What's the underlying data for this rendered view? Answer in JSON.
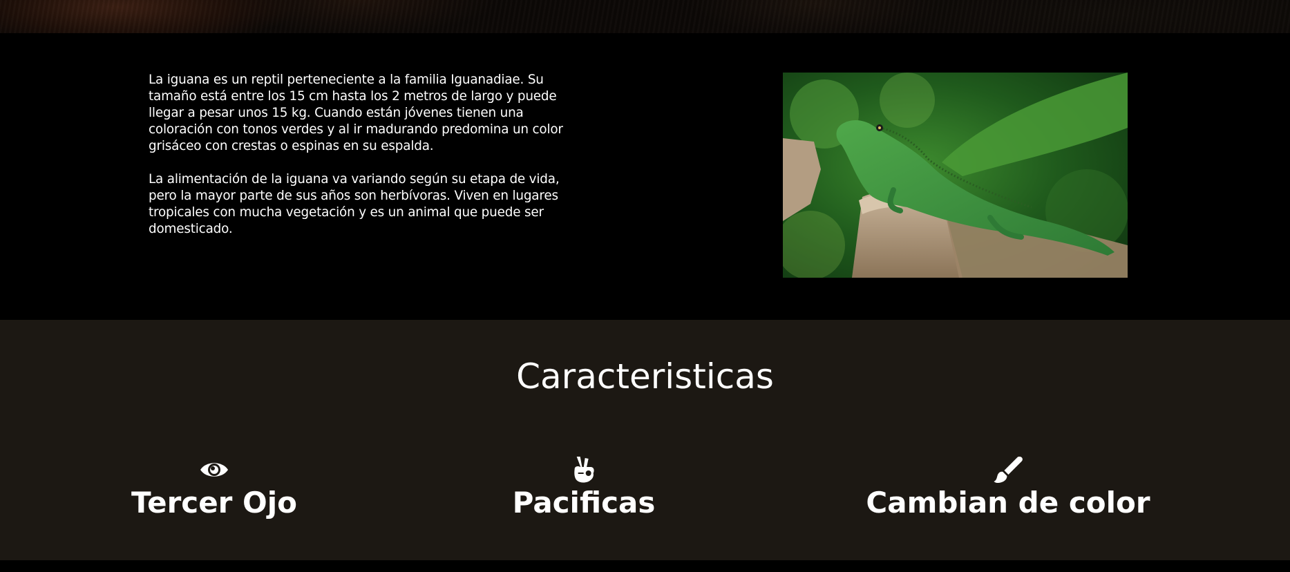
{
  "about": {
    "paragraphs": [
      "La iguana es un reptil perteneciente a la familia Iguanadiae. Su tamaño está entre los 15 cm hasta los 2 metros de largo y puede llegar a pesar unos 15 kg. Cuando están jóvenes tienen una coloración con tonos verdes y al ir madurando predomina un color grisáceo con crestas o espinas en su espalda.",
      "La alimentación de la iguana va variando según su etapa de vida, pero la mayor parte de sus años son herbívoras. Viven en lugares tropicales con mucha vegetación y es un animal que puede ser domesticado."
    ]
  },
  "features": {
    "title": "Caracteristicas",
    "items": [
      {
        "icon": "eye-icon",
        "title": "Tercer Ojo"
      },
      {
        "icon": "peace-hand-icon",
        "title": "Pacificas"
      },
      {
        "icon": "paintbrush-icon",
        "title": "Cambian de color"
      }
    ]
  },
  "colors": {
    "about_bg": "#000000",
    "features_bg": "#1c1813",
    "text": "#ffffff"
  }
}
